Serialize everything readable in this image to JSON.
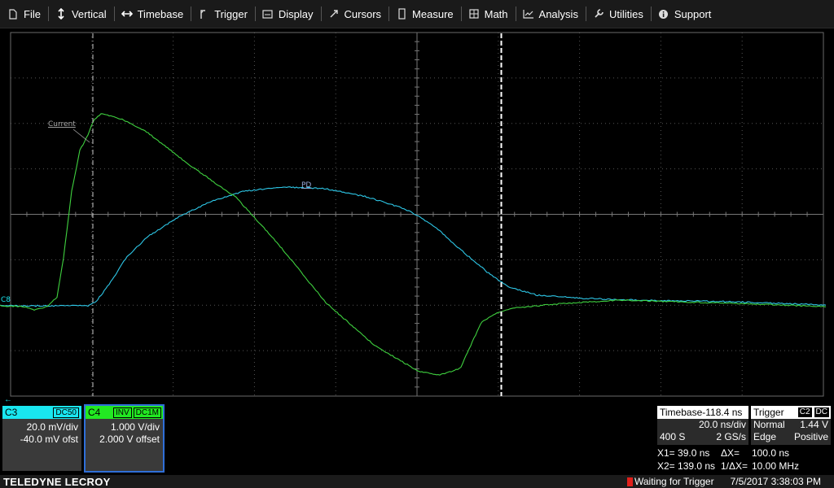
{
  "menu": [
    {
      "label": "File",
      "icon": "file-icon"
    },
    {
      "label": "Vertical",
      "icon": "vertical-arrows-icon"
    },
    {
      "label": "Timebase",
      "icon": "horizontal-arrows-icon"
    },
    {
      "label": "Trigger",
      "icon": "trigger-edge-icon"
    },
    {
      "label": "Display",
      "icon": "display-icon"
    },
    {
      "label": "Cursors",
      "icon": "cursor-icon"
    },
    {
      "label": "Measure",
      "icon": "measure-icon"
    },
    {
      "label": "Math",
      "icon": "calculator-icon"
    },
    {
      "label": "Analysis",
      "icon": "analysis-chart-icon"
    },
    {
      "label": "Utilities",
      "icon": "wrench-icon"
    },
    {
      "label": "Support",
      "icon": "info-icon"
    }
  ],
  "traces": {
    "current_label": "Current",
    "pd_label": "PD",
    "ground_marker": "C8",
    "current_color": "#3fd13f",
    "pd_color": "#2ec8e8"
  },
  "channels": {
    "c3": {
      "name": "C3",
      "coupling": "DC50",
      "scale": "20.0 mV/div",
      "offset": "-40.0 mV ofst",
      "color": "#19e6f0"
    },
    "c4": {
      "name": "C4",
      "inv": "INV",
      "coupling": "DC1M",
      "scale": "1.000 V/div",
      "offset": "2.000 V offset",
      "color": "#22e822"
    }
  },
  "timebase": {
    "header": "Timebase-118.4 ns",
    "per_div": "20.0 ns/div",
    "samples": "400 S",
    "rate": "2 GS/s"
  },
  "trigger": {
    "header": "Trigger",
    "source": "C2",
    "coupling": "DC",
    "mode": "Normal",
    "level": "1.44 V",
    "type": "Edge",
    "slope": "Positive"
  },
  "cursors": {
    "x1": "X1= 39.0 ns",
    "dx": "ΔX=",
    "dx_value": "100.0 ns",
    "x2": "X2= 139.0 ns",
    "inv_dx": "1/ΔX=",
    "inv_dx_value": "10.00 MHz"
  },
  "status": {
    "brand": "TELEDYNE LECROY",
    "message": "Waiting for Trigger",
    "datetime": "7/5/2017 3:38:03 PM"
  }
}
